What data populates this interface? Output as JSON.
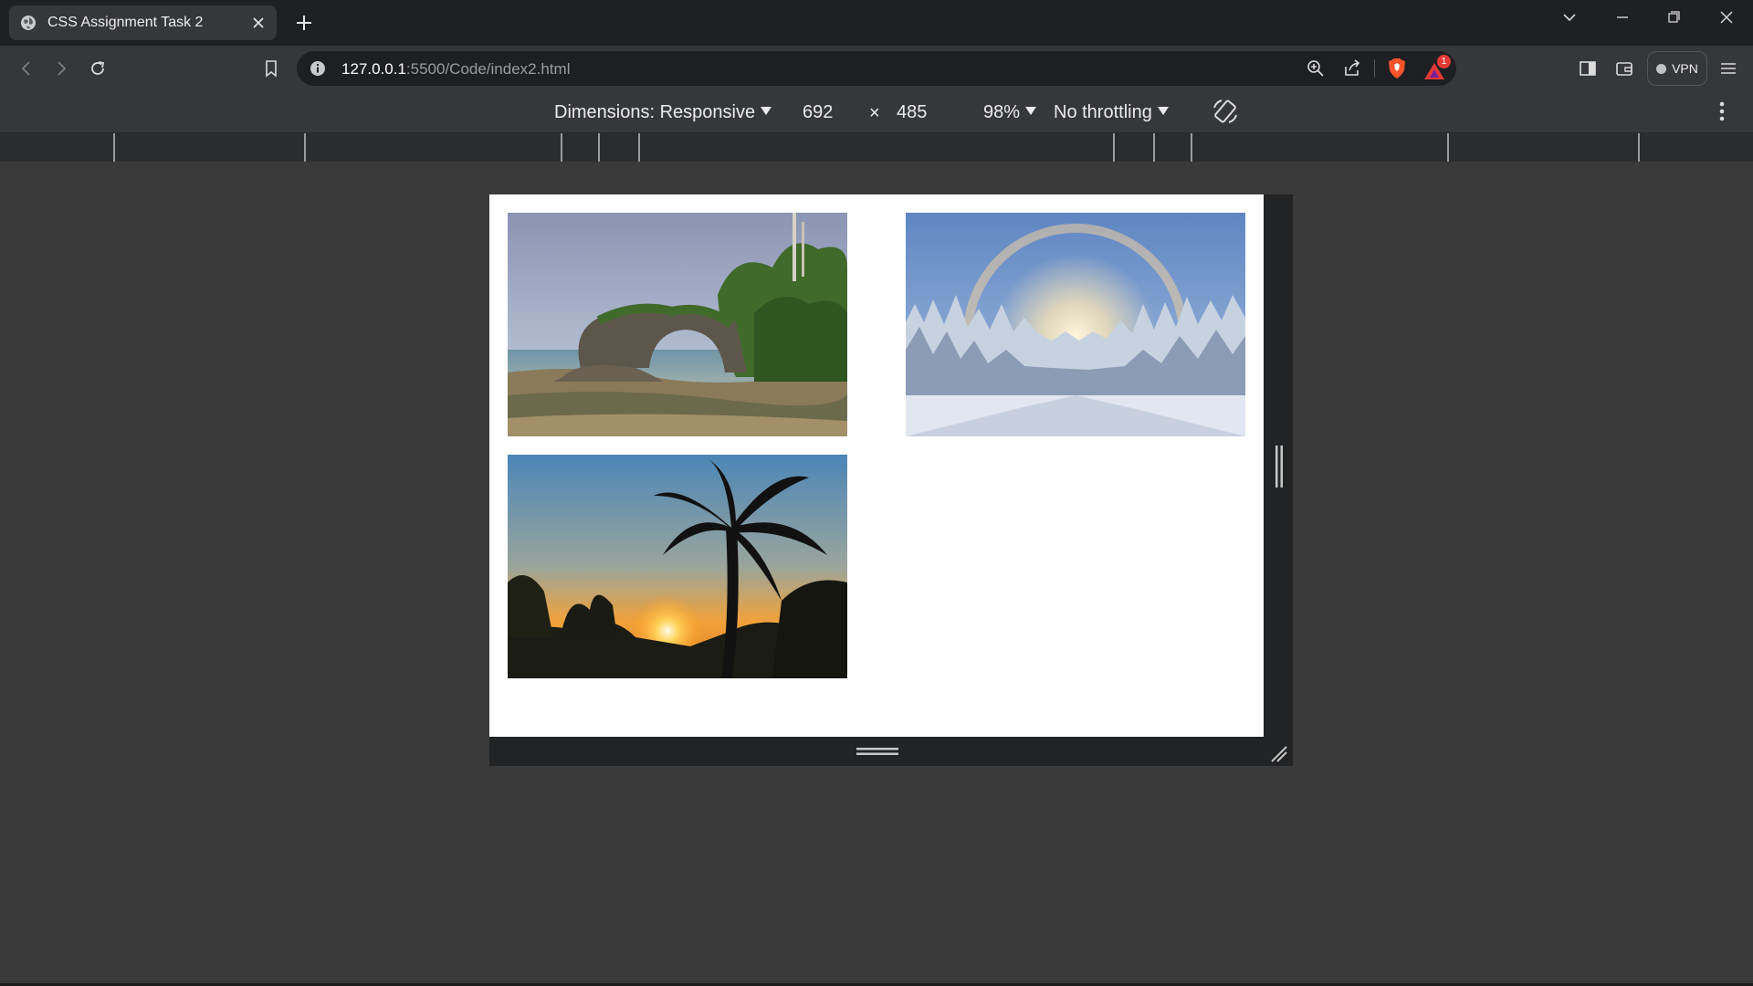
{
  "browser": {
    "tab_title": "CSS Assignment Task 2",
    "url_host": "127.0.0.1",
    "url_rest": ":5500/Code/index2.html",
    "vpn_label": "VPN",
    "alert_count": "1"
  },
  "devtools": {
    "dimensions_label": "Dimensions: Responsive",
    "width": "692",
    "times": "×",
    "height": "485",
    "zoom": "98%",
    "throttling": "No throttling"
  },
  "images": [
    {
      "subject": "rock-arch-beach"
    },
    {
      "subject": "snowy-forest-sun-halo"
    },
    {
      "subject": "palm-tree-sunset"
    }
  ],
  "colors": {
    "brave_orange": "#fb542b",
    "accent_red": "#e53935"
  }
}
